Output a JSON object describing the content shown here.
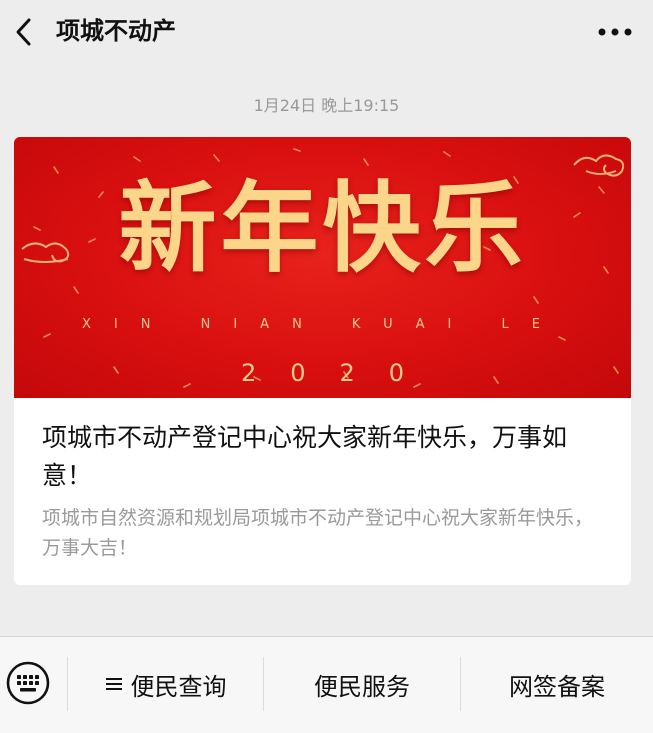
{
  "header": {
    "title": "项城不动产",
    "back_icon": "chevron-left-icon",
    "more_icon": "more-dots-icon"
  },
  "message": {
    "timestamp": "1月24日 晚上19:15"
  },
  "article": {
    "banner": {
      "headline": "新年快乐",
      "pinyin": "XIN NIAN KUAI LE",
      "year": "2020",
      "background_color": "#d80f0f",
      "text_color": "#fbd68a"
    },
    "title": "项城市不动产登记中心祝大家新年快乐，万事如意！",
    "description": "项城市自然资源和规划局项城市不动产登记中心祝大家新年快乐，万事大吉！"
  },
  "bottom_menu": {
    "keyboard_icon": "keyboard-icon",
    "items": [
      {
        "label": "便民查询",
        "icon": "menu-lines-icon"
      },
      {
        "label": "便民服务"
      },
      {
        "label": "网签备案"
      }
    ]
  }
}
